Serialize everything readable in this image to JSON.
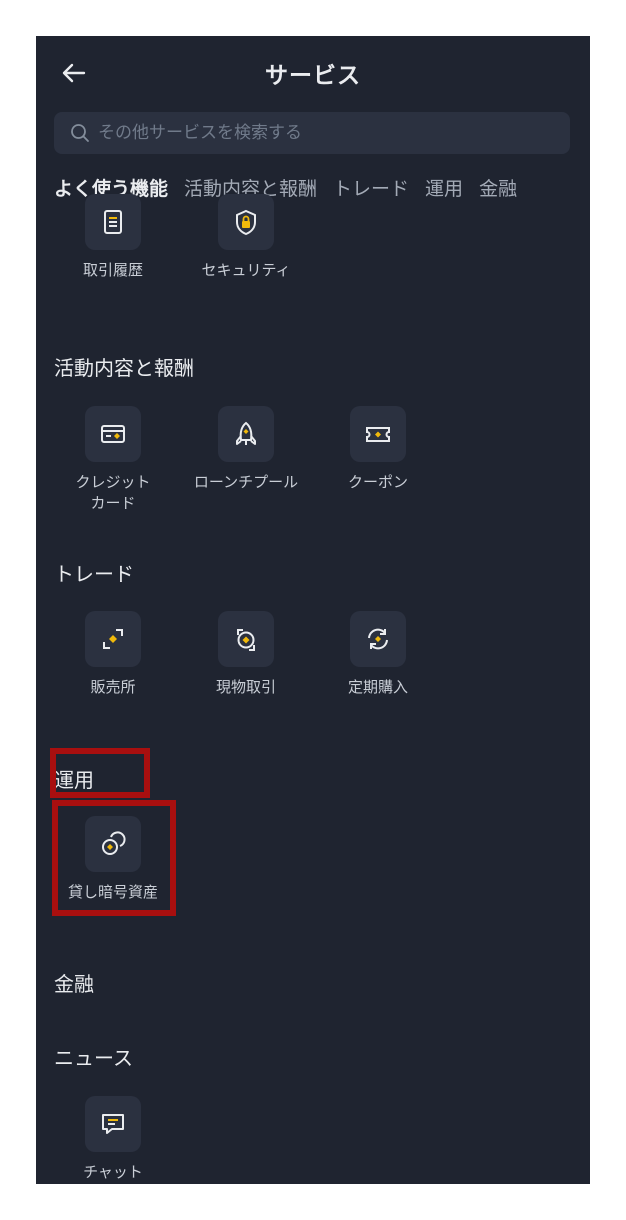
{
  "header": {
    "title": "サービス",
    "back_icon": "arrow-left-icon"
  },
  "search": {
    "placeholder": "その他サービスを検索する",
    "icon": "search-icon"
  },
  "tabs": [
    {
      "label": "よく使う機能",
      "active": true
    },
    {
      "label": "活動内容と報酬",
      "active": false
    },
    {
      "label": "トレード",
      "active": false
    },
    {
      "label": "運用",
      "active": false
    },
    {
      "label": "金融",
      "active": false
    }
  ],
  "frequent": {
    "items": [
      {
        "label": "取引履歴",
        "icon": "document-list-icon"
      },
      {
        "label": "セキュリティ",
        "icon": "shield-lock-icon"
      }
    ]
  },
  "activity": {
    "title": "活動内容と報酬",
    "items": [
      {
        "label_lines": [
          "クレジット",
          "カード"
        ],
        "icon": "credit-card-icon"
      },
      {
        "label": "ローンチプール",
        "icon": "rocket-icon"
      },
      {
        "label": "クーポン",
        "icon": "ticket-icon"
      }
    ]
  },
  "trade": {
    "title": "トレード",
    "items": [
      {
        "label": "販売所",
        "icon": "convert-icon"
      },
      {
        "label": "現物取引",
        "icon": "spot-trade-icon"
      },
      {
        "label": "定期購入",
        "icon": "recurring-buy-icon"
      }
    ]
  },
  "earn": {
    "title": "運用",
    "items": [
      {
        "label": "貸し暗号資産",
        "icon": "crypto-lending-icon"
      }
    ]
  },
  "finance": {
    "title": "金融"
  },
  "news": {
    "title": "ニュース",
    "items": [
      {
        "label": "チャット",
        "icon": "chat-icon"
      }
    ]
  },
  "colors": {
    "background": "#1f2430",
    "tile": "#2b3140",
    "accent": "#f0b90b",
    "highlight": "#a80f0f"
  }
}
